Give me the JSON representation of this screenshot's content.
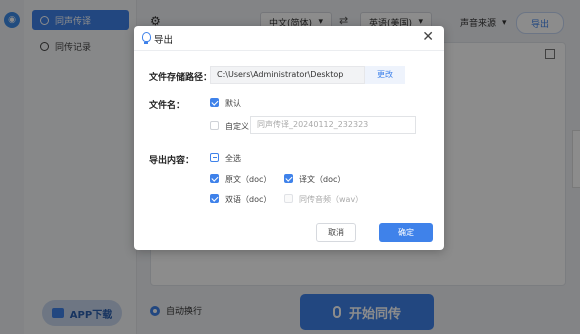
{
  "sidebar": {
    "items": [
      {
        "label": "同声传译",
        "active": true
      },
      {
        "label": "同传记录",
        "active": false
      }
    ],
    "app_download": "APP下载"
  },
  "toolbar": {
    "source_language": "中文(简体)",
    "target_language": "英语(美国)",
    "audio_source": "声音来源",
    "export_label": "导出"
  },
  "bottom": {
    "auto_wrap": "自动换行",
    "start": "开始同传"
  },
  "dialog": {
    "title": "导出",
    "path_label": "文件存储路径：",
    "path_value": "C:\\Users\\Administrator\\Desktop",
    "change_label": "更改",
    "filename_label": "文件名：",
    "default_option": "默认",
    "custom_option": "自定义",
    "custom_placeholder": "同声传译_20240112_232323",
    "content_label": "导出内容：",
    "select_all": "全选",
    "original": "原文（doc）",
    "translation": "译文（doc）",
    "bilingual": "双语（doc）",
    "audio": "同传音频（wav）",
    "cancel": "取消",
    "confirm": "确定"
  },
  "colors": {
    "accent": "#3f82ea",
    "overlay": "rgba(0,0,0,0.45)"
  }
}
